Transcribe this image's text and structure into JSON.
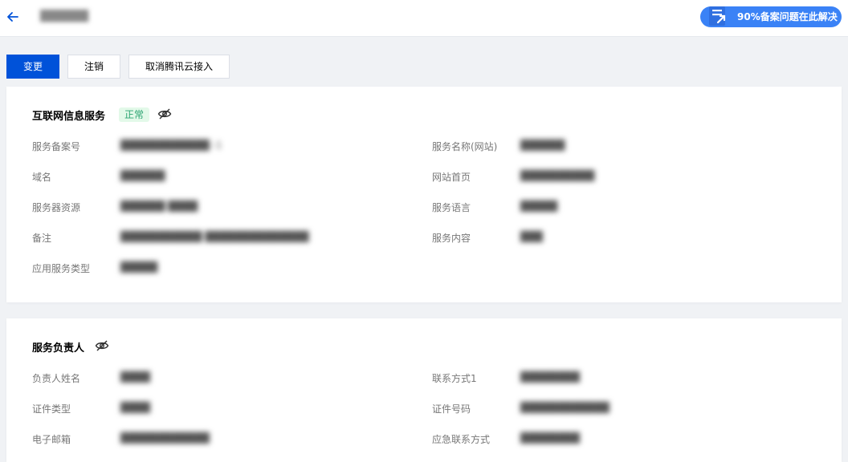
{
  "header": {
    "title": "██████",
    "help_badge": "90%备案问题在此解决"
  },
  "toolbar": {
    "change_label": "变更",
    "cancel_label": "注销",
    "cancel_access_label": "取消腾讯云接入"
  },
  "service_card": {
    "title": "互联网信息服务",
    "status": "正常",
    "fields": {
      "service_record_no": {
        "label": "服务备案号",
        "value": "████████████ -1"
      },
      "service_name": {
        "label": "服务名称(网站)",
        "value": "██████"
      },
      "domain": {
        "label": "域名",
        "value": "██████"
      },
      "homepage": {
        "label": "网站首页",
        "value": "██████████"
      },
      "server_resource": {
        "label": "服务器资源",
        "value": "██████ ████"
      },
      "service_language": {
        "label": "服务语言",
        "value": "█████"
      },
      "remark": {
        "label": "备注",
        "value": "███████████ ██████████████"
      },
      "service_content": {
        "label": "服务内容",
        "value": "███"
      },
      "app_service_type": {
        "label": "应用服务类型",
        "value": "█████"
      }
    }
  },
  "owner_card": {
    "title": "服务负责人",
    "fields": {
      "owner_name": {
        "label": "负责人姓名",
        "value": "████"
      },
      "contact1": {
        "label": "联系方式1",
        "value": "████████"
      },
      "id_type": {
        "label": "证件类型",
        "value": "████"
      },
      "id_number": {
        "label": "证件号码",
        "value": "████████████"
      },
      "email": {
        "label": "电子邮箱",
        "value": "████████████"
      },
      "emergency_contact": {
        "label": "应急联系方式",
        "value": "████████"
      }
    }
  },
  "colors": {
    "primary": "#0052d9",
    "status_green": "#2ba471",
    "status_bg": "#e3f9e9",
    "page_bg": "#f0f2f5"
  },
  "icons": {
    "back": "arrow-left-icon",
    "visibility": "eye-off-icon",
    "doc": "document-icon"
  }
}
